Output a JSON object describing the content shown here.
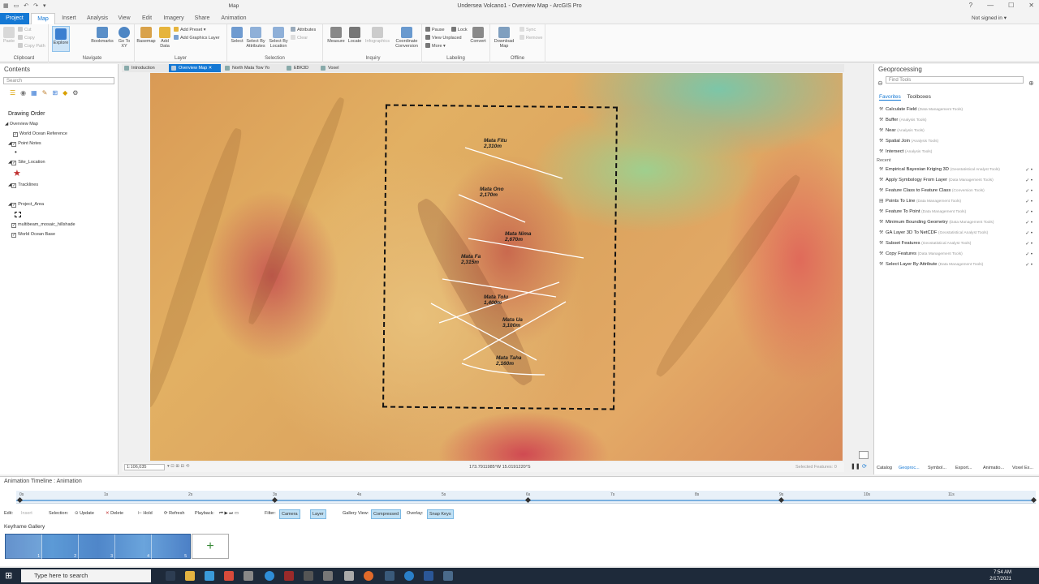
{
  "window": {
    "title": "Undersea Volcano1 - Overview Map - ArcGIS Pro",
    "context_tab_group": "Map",
    "help": "?",
    "minimize": "—",
    "maximize": "☐",
    "close": "✕"
  },
  "qat": [
    "▦",
    "▭",
    "↶",
    "↷",
    "▾"
  ],
  "ribbon_tabs": [
    "Project",
    "Map",
    "Insert",
    "Analysis",
    "View",
    "Edit",
    "Imagery",
    "Share",
    "Animation"
  ],
  "active_tab": "Map",
  "signin": "Not signed in ▾",
  "ribbon": {
    "clipboard": {
      "label": "Clipboard",
      "paste": "Paste",
      "cut": "Cut",
      "copy": "Copy",
      "copy_path": "Copy Path"
    },
    "navigate": {
      "label": "Navigate",
      "explore": "Explore",
      "bookmarks": "Bookmarks",
      "goto_xy": "Go To XY"
    },
    "layer": {
      "label": "Layer",
      "basemap": "Basemap",
      "add_data": "Add Data",
      "add_preset": "Add Preset ▾",
      "add_graphics": "Add Graphics Layer"
    },
    "selection": {
      "label": "Selection",
      "select": "Select",
      "select_by_attr": "Select By Attributes",
      "select_by_loc": "Select By Location",
      "attributes": "Attributes",
      "clear": "Clear"
    },
    "inquiry": {
      "label": "Inquiry",
      "measure": "Measure",
      "locate": "Locate",
      "infographics": "Infographics",
      "coord_conv": "Coordinate Conversion"
    },
    "labeling": {
      "label": "Labeling",
      "pause": "Pause",
      "lock": "Lock",
      "view_unplaced": "View Unplaced",
      "more": "More ▾",
      "convert": "Convert"
    },
    "offline": {
      "label": "Offline",
      "download_map": "Download Map",
      "sync": "Sync",
      "remove": "Remove"
    }
  },
  "contents": {
    "title": "Contents",
    "search_placeholder": "Search",
    "drawing_order": "Drawing Order",
    "layers": [
      "Overview Map",
      "World Ocean Reference",
      "Point Notes",
      "Site_Location",
      "Tracklines",
      "Project_Area",
      "multibeam_mosaic_hillshade",
      "World Ocean Base"
    ]
  },
  "view_tabs": [
    "Introduction",
    "Overview Map",
    "North Mata Tow Yo",
    "EBK3D",
    "Voxel"
  ],
  "active_view": "Overview Map",
  "map": {
    "peaks": [
      {
        "name": "Mata Fitu",
        "depth": "2,310m"
      },
      {
        "name": "Mata Ono",
        "depth": "2,170m"
      },
      {
        "name": "Mata Nima",
        "depth": "2,670m"
      },
      {
        "name": "Mata Fa",
        "depth": "2,315m"
      },
      {
        "name": "Mata Tolu",
        "depth": "1,400m"
      },
      {
        "name": "Mata Ua",
        "depth": "3,100m"
      },
      {
        "name": "Mata Taha",
        "depth": "2,160m"
      }
    ],
    "scale": "1:106,035",
    "coordinates": "173.7911985°W 15.0191220°S",
    "selected_features": "Selected Features: 0"
  },
  "geoprocessing": {
    "title": "Geoprocessing",
    "search_placeholder": "Find Tools",
    "tab_favorites": "Favorites",
    "tab_toolboxes": "Toolboxes",
    "recent_label": "Recent",
    "favorites": [
      {
        "name": "Calculate Field",
        "box": "(Data Management Tools)"
      },
      {
        "name": "Buffer",
        "box": "(Analysis Tools)"
      },
      {
        "name": "Near",
        "box": "(Analysis Tools)"
      },
      {
        "name": "Spatial Join",
        "box": "(Analysis Tools)"
      },
      {
        "name": "Intersect",
        "box": "(Analysis Tools)"
      }
    ],
    "recent": [
      {
        "name": "Empirical Bayesian Kriging 3D",
        "box": "(Geostatistical Analyst Tools)"
      },
      {
        "name": "Apply Symbology From Layer",
        "box": "(Data Management Tools)"
      },
      {
        "name": "Feature Class to Feature Class",
        "box": "(Conversion Tools)"
      },
      {
        "name": "Points To Line",
        "box": "(Data Management Tools)"
      },
      {
        "name": "Feature To Point",
        "box": "(Data Management Tools)"
      },
      {
        "name": "Minimum Bounding Geometry",
        "box": "(Data Management Tools)"
      },
      {
        "name": "GA Layer 3D To NetCDF",
        "box": "(Geostatistical Analyst Tools)"
      },
      {
        "name": "Subset Features",
        "box": "(Geostatistical Analyst Tools)"
      },
      {
        "name": "Copy Features",
        "box": "(Data Management Tools)"
      },
      {
        "name": "Select Layer By Attribute",
        "box": "(Data Management Tools)"
      }
    ],
    "bottom_tabs": [
      "Catalog",
      "Geoproc...",
      "Symbol...",
      "Export...",
      "Animatio...",
      "Voxel Ex..."
    ]
  },
  "timeline": {
    "title": "Animation Timeline : Animation",
    "ticks": [
      "0s",
      "1s",
      "2s",
      "3s",
      "4s",
      "5s",
      "6s",
      "7s",
      "8s",
      "9s",
      "10s",
      "11s"
    ],
    "edit": "Edit:",
    "insert": "Insert",
    "selection": "Selection:",
    "update": "Update",
    "delete": "Delete",
    "hold": "Hold",
    "refresh": "Refresh",
    "playback": "Playback:",
    "filter": "Filter:",
    "camera": "Camera",
    "layer": "Layer",
    "gallery_view": "Gallery View:",
    "compressed": "Compressed",
    "overlay": "Overlay:",
    "snap_keys": "Snap Keys",
    "gallery_title": "Keyframe Gallery",
    "keyframes": [
      "1",
      "2",
      "3",
      "4",
      "5"
    ],
    "add_symbol": "+"
  },
  "taskbar": {
    "search": "Type here to search",
    "time": "7:54 AM",
    "date": "2/17/2021"
  }
}
